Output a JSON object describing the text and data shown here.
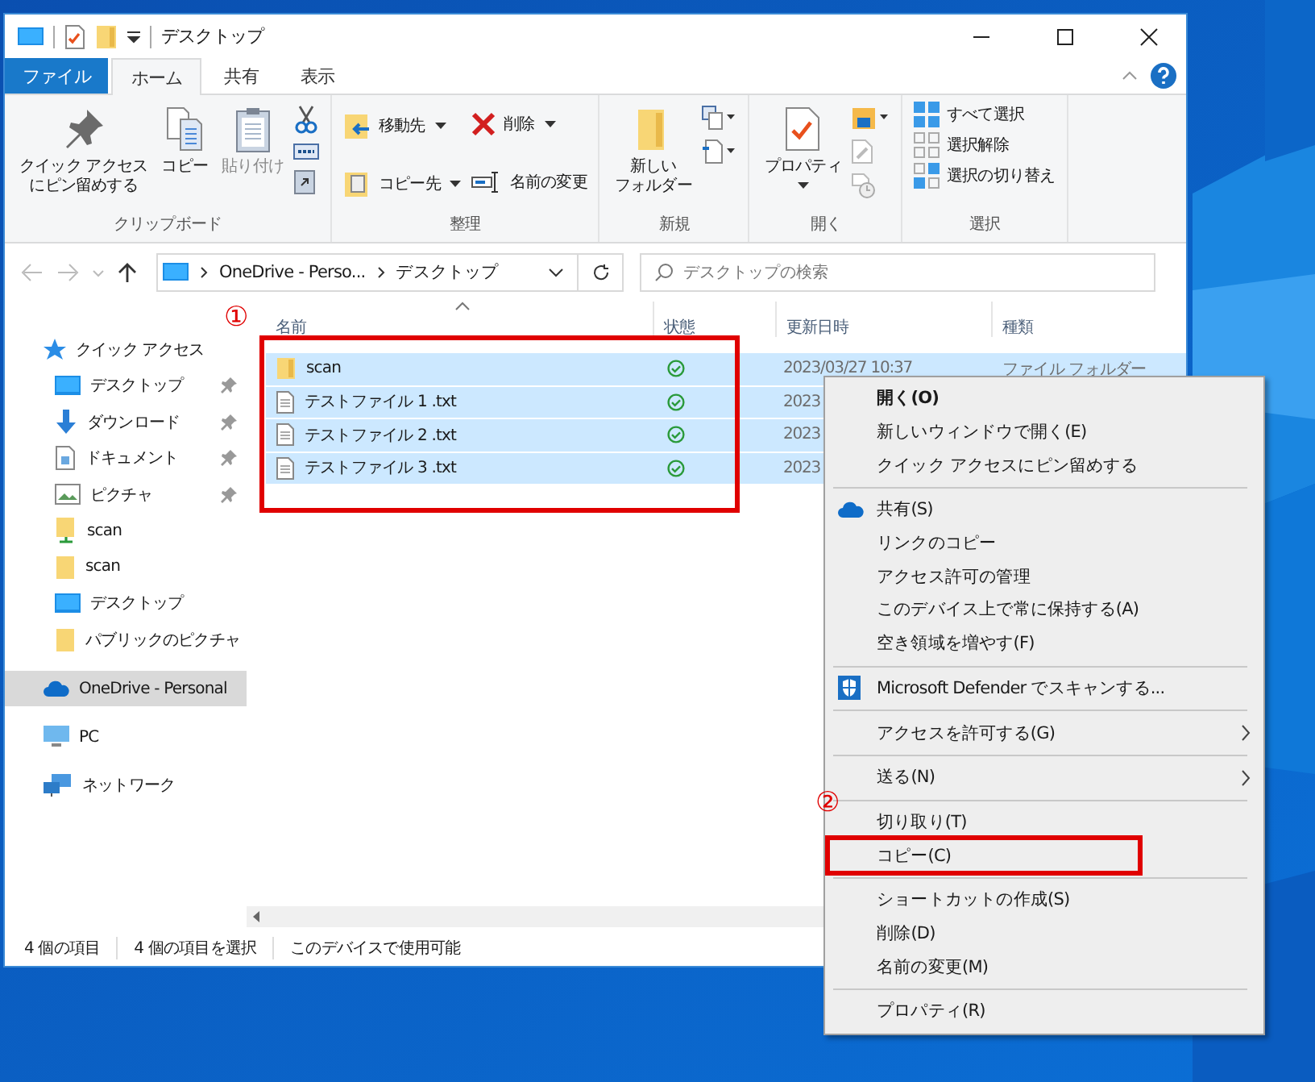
{
  "window": {
    "title": "デスクトップ"
  },
  "ribbon": {
    "tabs": [
      {
        "label": "ファイル",
        "kind": "file",
        "selected": false
      },
      {
        "label": "ホーム",
        "kind": "tab",
        "selected": true
      },
      {
        "label": "共有",
        "kind": "tab",
        "selected": false
      },
      {
        "label": "表示",
        "kind": "tab",
        "selected": false
      }
    ],
    "groups": [
      {
        "label": "クリップボード",
        "buttons": [
          {
            "lines": [
              "クイック アクセス",
              "にピン留めする"
            ],
            "kind": "pin",
            "disabled": false
          },
          {
            "lines": [
              "コピー"
            ],
            "kind": "copy",
            "disabled": false
          },
          {
            "lines": [
              "貼り付け"
            ],
            "kind": "paste",
            "disabled": true
          }
        ]
      },
      {
        "label": "整理",
        "buttons": [
          {
            "label": "移動先",
            "kind": "move",
            "dropdown": true
          },
          {
            "label": "削除",
            "kind": "delete",
            "dropdown": true
          },
          {
            "label": "コピー先",
            "kind": "copyto",
            "dropdown": true
          },
          {
            "label": "名前の変更",
            "kind": "rename",
            "dropdown": false
          }
        ]
      },
      {
        "label": "新規",
        "buttons": [
          {
            "lines": [
              "新しい",
              "フォルダー"
            ],
            "kind": "folder"
          }
        ]
      },
      {
        "label": "開く",
        "buttons": [
          {
            "lines": [
              "プロパティ"
            ],
            "kind": "properties",
            "dropdown": true
          }
        ]
      },
      {
        "label": "選択",
        "buttons": [
          {
            "label": "すべて選択",
            "kind": "all"
          },
          {
            "label": "選択解除",
            "kind": "none"
          },
          {
            "label": "選択の切り替え",
            "kind": "invert"
          }
        ]
      }
    ]
  },
  "address": {
    "crumbs": [
      "OneDrive - Perso...",
      "デスクトップ"
    ]
  },
  "search": {
    "placeholder": "デスクトップの検索"
  },
  "navigation": [
    {
      "label": "クイック アクセス",
      "kind": "star",
      "selected": false,
      "children": [
        {
          "label": "デスクトップ",
          "kind": "desktop",
          "selected": false,
          "pinned": true
        },
        {
          "label": "ダウンロード",
          "kind": "download",
          "selected": false,
          "pinned": true
        },
        {
          "label": "ドキュメント",
          "kind": "document",
          "selected": false,
          "pinned": true
        },
        {
          "label": "ピクチャ",
          "kind": "picture",
          "selected": false,
          "pinned": true
        },
        {
          "label": "scan",
          "kind": "share",
          "selected": false,
          "pinned": false
        },
        {
          "label": "scan",
          "kind": "folder",
          "selected": false,
          "pinned": false
        },
        {
          "label": "デスクトップ",
          "kind": "desktop",
          "selected": false,
          "pinned": false
        },
        {
          "label": "パブリックのピクチャ",
          "kind": "folder",
          "selected": false,
          "pinned": false
        }
      ]
    },
    {
      "label": "OneDrive - Personal",
      "kind": "cloud",
      "selected": true
    },
    {
      "label": "PC",
      "kind": "pc",
      "selected": false
    },
    {
      "label": "ネットワーク",
      "kind": "network",
      "selected": false
    }
  ],
  "table": {
    "columns": [
      "名前",
      "状態",
      "更新日時",
      "種類"
    ],
    "rows": [
      {
        "name": "scan",
        "kind": "folder",
        "modified": "2023/03/27 10:37",
        "type": "ファイル フォルダー",
        "selected": true
      },
      {
        "name": "テストファイル 1 .txt",
        "kind": "text",
        "modified": "2023",
        "selected": true
      },
      {
        "name": "テストファイル 2 .txt",
        "kind": "text",
        "modified": "2023",
        "selected": true
      },
      {
        "name": "テストファイル 3 .txt",
        "kind": "text",
        "modified": "2023",
        "selected": true
      }
    ]
  },
  "status_bar": [
    "4 個の項目",
    "4 個の項目を選択",
    "このデバイスで使用可能"
  ],
  "context_menu": [
    {
      "label": "開く(O)",
      "kind": "default",
      "highlighted": false
    },
    {
      "label": "新しいウィンドウで開く(E)",
      "kind": "item",
      "highlighted": false
    },
    {
      "label": "クイック アクセスにピン留めする",
      "kind": "item",
      "highlighted": false
    },
    {
      "kind": "separator"
    },
    {
      "label": "共有(S)",
      "kind": "cloud",
      "highlighted": false
    },
    {
      "label": "リンクのコピー",
      "kind": "item",
      "highlighted": false
    },
    {
      "label": "アクセス許可の管理",
      "kind": "item",
      "highlighted": false
    },
    {
      "label": "このデバイス上で常に保持する(A)",
      "kind": "item",
      "highlighted": false
    },
    {
      "label": "空き領域を増やす(F)",
      "kind": "item",
      "highlighted": false
    },
    {
      "kind": "separator"
    },
    {
      "label": "Microsoft Defender でスキャンする...",
      "kind": "shield",
      "highlighted": false
    },
    {
      "kind": "separator"
    },
    {
      "label": "アクセスを許可する(G)",
      "kind": "submenu",
      "highlighted": false
    },
    {
      "kind": "separator"
    },
    {
      "label": "送る(N)",
      "kind": "submenu",
      "highlighted": false
    },
    {
      "kind": "separator"
    },
    {
      "label": "切り取り(T)",
      "kind": "item",
      "highlighted": false
    },
    {
      "label": "コピー(C)",
      "kind": "item",
      "highlighted": true
    },
    {
      "kind": "separator"
    },
    {
      "label": "ショートカットの作成(S)",
      "kind": "item",
      "highlighted": false
    },
    {
      "label": "削除(D)",
      "kind": "item",
      "highlighted": false
    },
    {
      "label": "名前の変更(M)",
      "kind": "item",
      "highlighted": false
    },
    {
      "kind": "separator"
    },
    {
      "label": "プロパティ(R)",
      "kind": "item",
      "highlighted": false
    }
  ],
  "annotations": [
    "①",
    "②"
  ]
}
